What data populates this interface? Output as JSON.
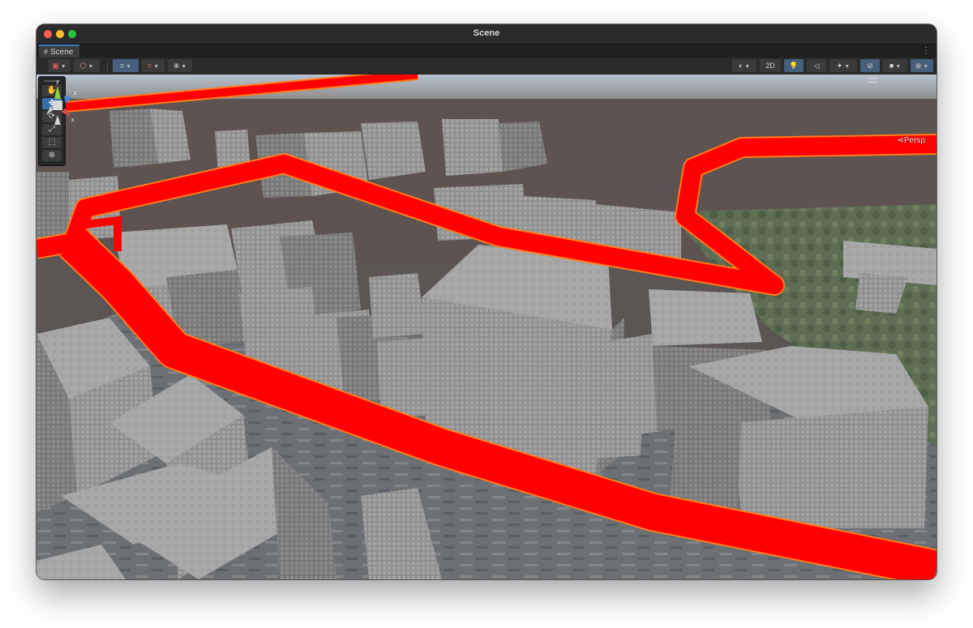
{
  "window": {
    "title": "Scene"
  },
  "tab": {
    "label": "Scene",
    "menu_icon": "kebab-menu-icon"
  },
  "toolbar": {
    "left": [
      {
        "name": "draw-mode-button",
        "icon": "shaded-icon"
      },
      {
        "name": "render-mode-button",
        "icon": "cube-icon"
      },
      {
        "name": "grid-snap-button",
        "icon": "grid-snap-icon"
      },
      {
        "name": "increment-snap-button",
        "icon": "snap-increment-icon"
      },
      {
        "name": "ruler-button",
        "icon": "ruler-icon"
      }
    ],
    "right": [
      {
        "name": "shading-button",
        "icon": "sphere-icon"
      },
      {
        "name": "2d-toggle",
        "label": "2D"
      },
      {
        "name": "lighting-toggle",
        "icon": "bulb-icon"
      },
      {
        "name": "audio-toggle",
        "icon": "audio-icon"
      },
      {
        "name": "effects-button",
        "icon": "effects-icon"
      },
      {
        "name": "visibility-toggle",
        "icon": "eye-off-icon"
      },
      {
        "name": "camera-button",
        "icon": "camera-icon"
      },
      {
        "name": "gizmos-button",
        "icon": "gizmo-icon"
      }
    ],
    "twod_label": "2D"
  },
  "tools": [
    {
      "name": "hand-tool",
      "glyph": "✋",
      "selected": false
    },
    {
      "name": "move-tool",
      "glyph": "✥",
      "selected": true
    },
    {
      "name": "rotate-tool",
      "glyph": "⟳",
      "selected": false
    },
    {
      "name": "scale-tool",
      "glyph": "⤢",
      "selected": false
    },
    {
      "name": "rect-tool",
      "glyph": "⬚",
      "selected": false
    },
    {
      "name": "transform-tool",
      "glyph": "⊕",
      "selected": false
    }
  ],
  "gizmo": {
    "y_label": "y",
    "z_label": "z",
    "x_label": "x",
    "projection_label": "Persp"
  },
  "colors": {
    "route": "#ff0000",
    "route_edge": "#ff7a1a",
    "ground": "#5e5652",
    "sky": "#a9b6c2",
    "building": "#9a9a9a"
  }
}
